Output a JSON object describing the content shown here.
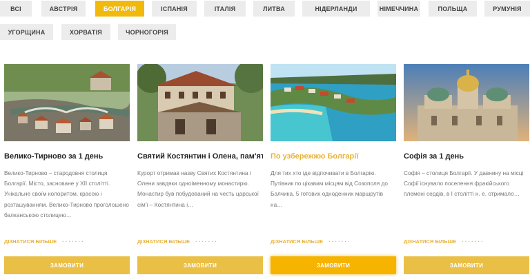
{
  "filters": [
    "ВСІ",
    "АВСТРІЯ",
    "БОЛГАРІЯ",
    "ІСПАНІЯ",
    "ІТАЛІЯ",
    "ЛИТВА",
    "НІДЕРЛАНДИ",
    "НІМЕЧЧИНА",
    "ПОЛЬЩА",
    "РУМУНІЯ",
    "УГОРЩИНА",
    "ХОРВАТІЯ",
    "ЧОРНОГОРІЯ"
  ],
  "active_filter": "БОЛГАРІЯ",
  "accent_color": "#f0b90b",
  "cards": [
    {
      "title": "Велико-Тирново за 1 день",
      "desc": "Велико-Тирново – стародовня столиця Болгарії. Місто, засноване у XII столітті. Унікальне своїм колоритом, красою і розташуванням. Велико-Тирново проголошено балканською столицею…",
      "more": "ДІЗНАТИСЯ БІЛЬШЕ",
      "order": "ЗАМОВИТИ",
      "image": "town-bridge-photo"
    },
    {
      "title": "Святий Костянтин і Олена, пам'ятки",
      "desc": "Курорт отримав назву Святих Костянтина і Олени завдяки одноіменному монастирю. Монастир був побудований на честь царської сім'ї – Костянтина і…",
      "more": "ДІЗНАТИСЯ БІЛЬШЕ",
      "order": "ЗАМОВИТИ",
      "image": "monastery-photo"
    },
    {
      "title": "По узбережжю Болгарії",
      "desc": "Для тих хто іде відпочивати в Болгарію. Путівник по цікавим місцям від Созополя до Балчика. 5 готових одноденних маршрутів на…",
      "more": "ДІЗНАТИСЯ БІЛЬШЕ",
      "order": "ЗАМОВИТИ",
      "image": "coast-resort-photo"
    },
    {
      "title": "Софія за 1 день",
      "desc": "Софія – столиця Болгарії. У давнину на місці Софії існувало поселення фракійського племені сердів, в І столітті н. е. отримало…",
      "more": "ДІЗНАТИСЯ БІЛЬШЕ",
      "order": "ЗАМОВИТИ",
      "image": "cathedral-photo"
    }
  ]
}
